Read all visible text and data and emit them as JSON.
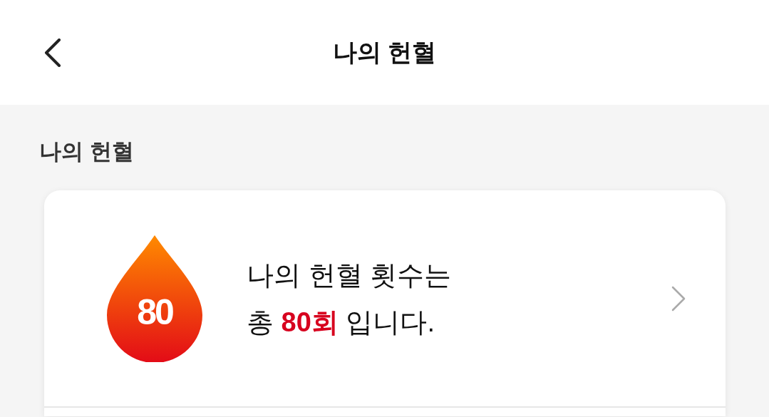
{
  "header": {
    "title": "나의 헌혈"
  },
  "section_title": "나의 헌혈",
  "donation_card": {
    "badge_count": "80",
    "message_lines": [
      "나의 헌혈 횟수는",
      "총 **80회** 입니다."
    ]
  }
}
